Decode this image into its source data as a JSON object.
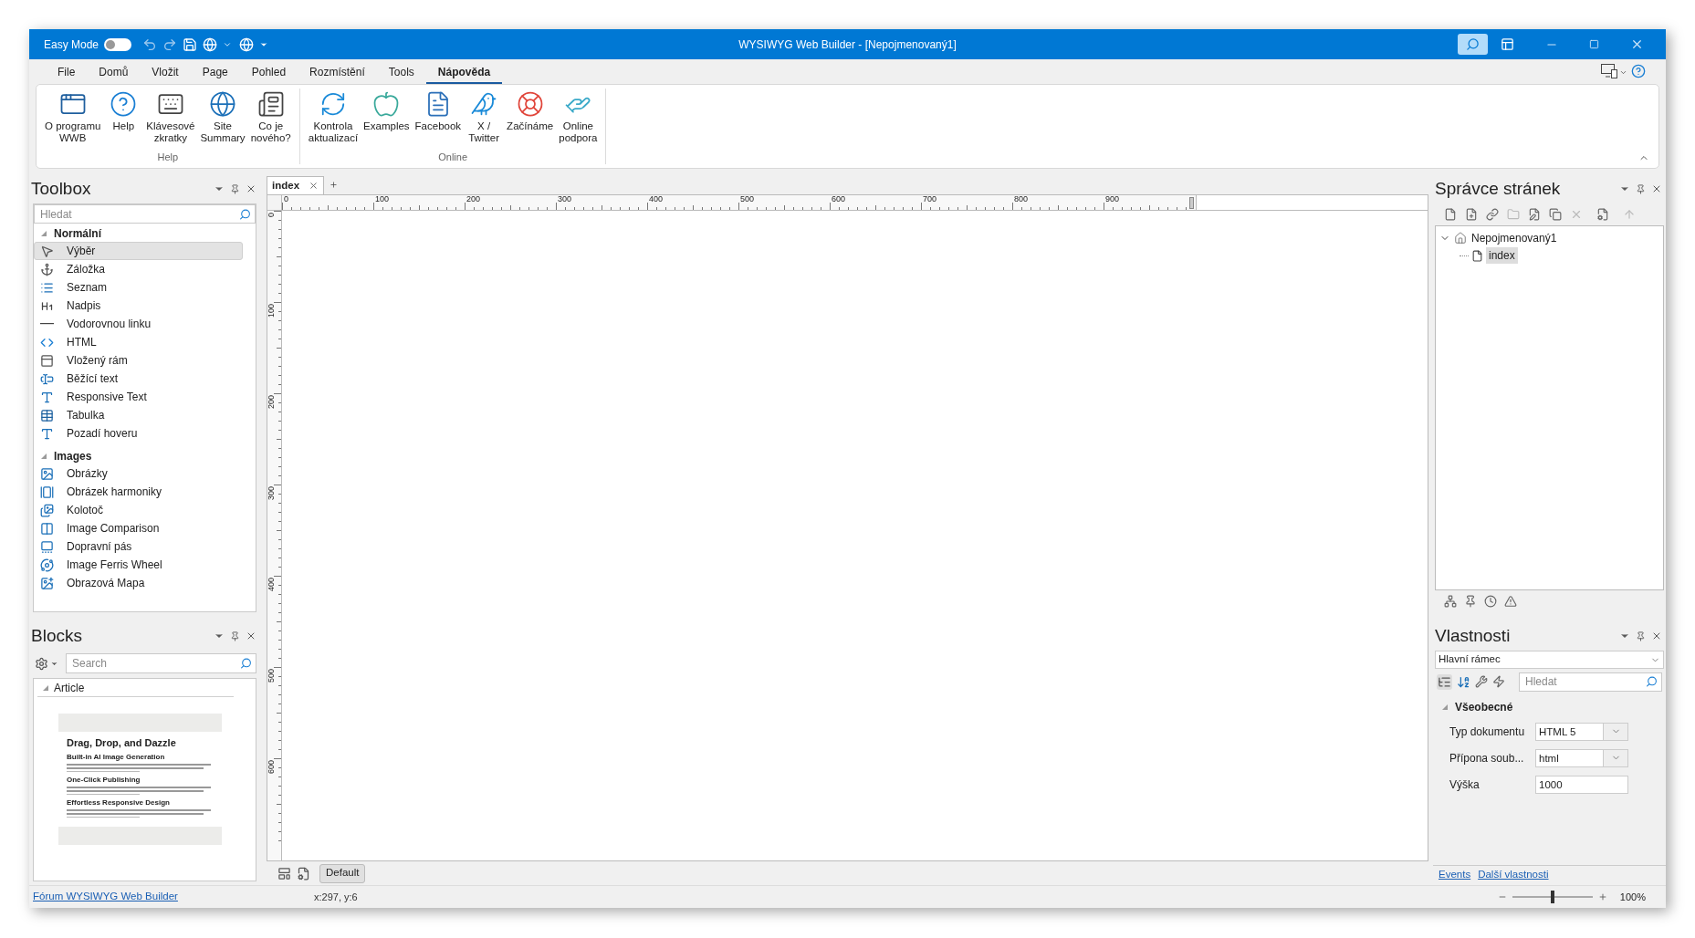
{
  "title_bar": {
    "easy_mode_label": "Easy Mode",
    "easy_mode_on": false,
    "title": "WYSIWYG Web Builder - [Nepojmenovaný1]"
  },
  "menu_tabs": [
    {
      "label": "File",
      "selected": false
    },
    {
      "label": "Domů",
      "selected": false
    },
    {
      "label": "Vložit",
      "selected": false
    },
    {
      "label": "Page",
      "selected": false
    },
    {
      "label": "Pohled",
      "selected": false
    },
    {
      "label": "Rozmístění",
      "selected": false
    },
    {
      "label": "Tools",
      "selected": false
    },
    {
      "label": "Nápověda",
      "selected": true
    }
  ],
  "ribbon_groups": [
    {
      "label": "Help",
      "buttons": [
        {
          "label": "O programu\nWWB"
        },
        {
          "label": "Help"
        },
        {
          "label": "Klávesové\nzkratky"
        },
        {
          "label": "Site\nSummary"
        },
        {
          "label": "Co je\nnového?"
        }
      ]
    },
    {
      "label": "Online",
      "buttons": [
        {
          "label": "Kontrola\naktualizací"
        },
        {
          "label": "Examples"
        },
        {
          "label": "Facebook"
        },
        {
          "label": "X /\nTwitter"
        },
        {
          "label": "Začínáme"
        },
        {
          "label": "Online\npodpora"
        }
      ]
    }
  ],
  "toolbox": {
    "title": "Toolbox",
    "search_placeholder": "Hledat",
    "sections": [
      {
        "label": "Normální",
        "expanded": true,
        "items": [
          {
            "label": "Výběr",
            "selected": true
          },
          {
            "label": "Záložka",
            "selected": false
          },
          {
            "label": "Seznam",
            "selected": false
          },
          {
            "label": "Nadpis",
            "selected": false
          },
          {
            "label": "Vodorovnou linku",
            "selected": false
          },
          {
            "label": "HTML",
            "selected": false
          },
          {
            "label": "Vložený rám",
            "selected": false
          },
          {
            "label": "Běžící text",
            "selected": false
          },
          {
            "label": "Responsive Text",
            "selected": false
          },
          {
            "label": "Tabulka",
            "selected": false
          },
          {
            "label": "Pozadí hoveru",
            "selected": false
          }
        ]
      },
      {
        "label": "Images",
        "expanded": true,
        "items": [
          {
            "label": "Obrázky",
            "selected": false
          },
          {
            "label": "Obrázek harmoniky",
            "selected": false
          },
          {
            "label": "Kolotoč",
            "selected": false
          },
          {
            "label": "Image Comparison",
            "selected": false
          },
          {
            "label": "Dopravní pás",
            "selected": false
          },
          {
            "label": "Image Ferris Wheel",
            "selected": false
          },
          {
            "label": "Obrazová Mapa",
            "selected": false
          }
        ]
      }
    ]
  },
  "blocks": {
    "title": "Blocks",
    "search_placeholder": "Search",
    "category": {
      "label": "Article",
      "expanded": true
    },
    "preview": {
      "title": "Drag, Drop, and Dazzle",
      "sections": [
        "Built-in AI Image Generation",
        "One-Click Publishing",
        "Effortless Responsive Design"
      ]
    }
  },
  "editor": {
    "tabs": [
      {
        "label": "index",
        "selected": true
      }
    ],
    "ruler": {
      "x_labels": [
        "0",
        "100",
        "200",
        "300",
        "400",
        "500",
        "600",
        "700",
        "800",
        "900"
      ],
      "y_labels": [
        "0",
        "100",
        "200",
        "300",
        "400",
        "500",
        "600"
      ]
    },
    "layout_button": "Default"
  },
  "page_manager": {
    "title": "Správce stránek",
    "tree": [
      {
        "label": "Nepojmenovaný1",
        "expanded": true,
        "selected": false,
        "children": [
          {
            "label": "index",
            "selected": true
          }
        ]
      }
    ]
  },
  "properties": {
    "title": "Vlastnosti",
    "object": "Hlavní rámec",
    "search_placeholder": "Hledat",
    "section": {
      "label": "Všeobecné",
      "expanded": true
    },
    "rows": [
      {
        "name": "Typ dokumentu",
        "value": "HTML 5",
        "kind": "dropdown"
      },
      {
        "name": "Přípona soub...",
        "value": "html",
        "kind": "dropdown"
      },
      {
        "name": "Výška",
        "value": "1000",
        "kind": "text"
      }
    ],
    "links": [
      "Events",
      "Další vlastnosti"
    ]
  },
  "status_bar": {
    "link": "Fórum WYSIWYG Web Builder",
    "position": "x:297, y:6",
    "zoom": {
      "level": 0.5,
      "label": "100%"
    }
  }
}
